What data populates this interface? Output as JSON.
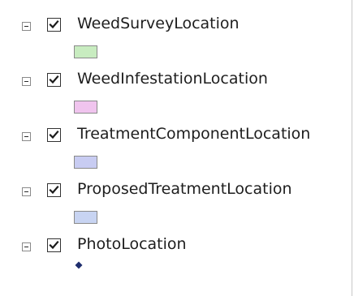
{
  "layers": [
    {
      "name": "WeedSurveyLocation",
      "symbol": "polygon-swatch",
      "fill": "#c8ecc0"
    },
    {
      "name": "WeedInfestationLocation",
      "symbol": "polygon-swatch",
      "fill": "#f0c4ee"
    },
    {
      "name": "TreatmentComponentLocation",
      "symbol": "polygon-swatch",
      "fill": "#c8ccf2"
    },
    {
      "name": "ProposedTreatmentLocation",
      "symbol": "polygon-swatch",
      "fill": "#c8d4f2"
    },
    {
      "name": "PhotoLocation",
      "symbol": "point-diamond",
      "fill": "#1f2e6e"
    }
  ],
  "expander_icon": "collapse-minus-icon",
  "checkbox_icon": "checkmark-icon",
  "checked": true
}
